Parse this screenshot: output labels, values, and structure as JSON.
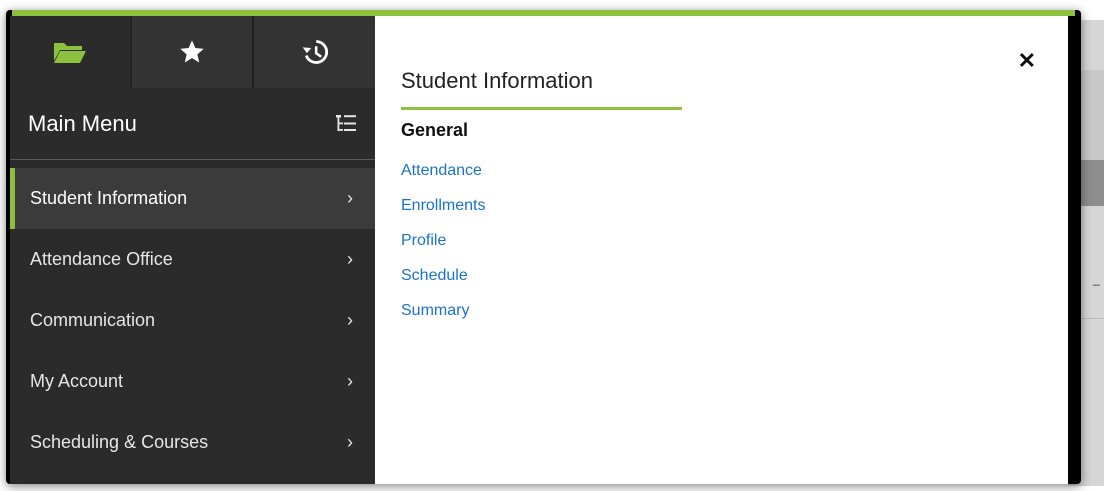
{
  "backdrop": {
    "fragment_text": "_"
  },
  "colors": {
    "accent": "#8dc03e",
    "nav_bg": "#2b2b2b",
    "link": "#1a73c7"
  },
  "nav": {
    "tabs": [
      {
        "icon": "folder-open-icon",
        "active": true
      },
      {
        "icon": "star-icon",
        "active": false
      },
      {
        "icon": "history-icon",
        "active": false
      }
    ],
    "title": "Main Menu",
    "header_icon": "menu-tree-icon",
    "items": [
      {
        "label": "Student Information",
        "selected": true
      },
      {
        "label": "Attendance Office",
        "selected": false
      },
      {
        "label": "Communication",
        "selected": false
      },
      {
        "label": "My Account",
        "selected": false
      },
      {
        "label": "Scheduling & Courses",
        "selected": false
      }
    ]
  },
  "panel": {
    "title": "Student Information",
    "close_label": "✕",
    "section": "General",
    "links": [
      "Attendance",
      "Enrollments",
      "Profile",
      "Schedule",
      "Summary"
    ]
  }
}
